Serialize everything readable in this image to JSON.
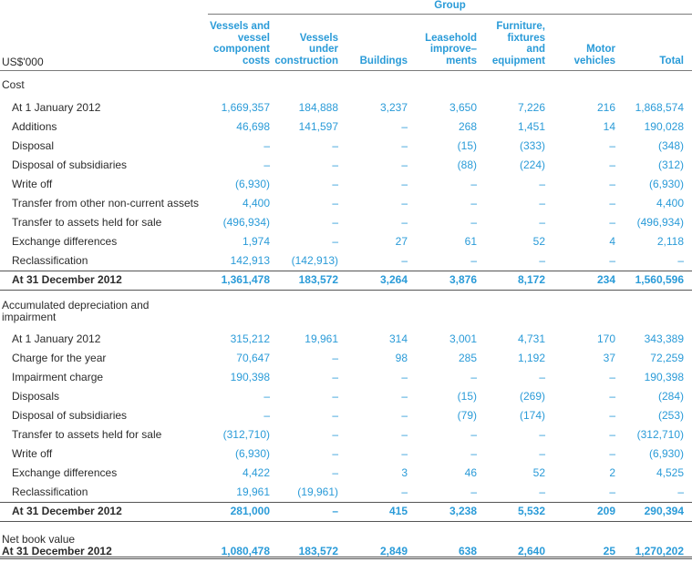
{
  "group_label": "Group",
  "unit_label": "US$'000",
  "columns": [
    [
      "Vessels and",
      "vessel",
      "component",
      "costs"
    ],
    [
      "Vessels",
      "under",
      "construction"
    ],
    [
      "Buildings"
    ],
    [
      "Leasehold",
      "improve–",
      "ments"
    ],
    [
      "Furniture,",
      "fixtures",
      "and",
      "equipment"
    ],
    [
      "Motor",
      "vehicles"
    ],
    [
      "Total"
    ]
  ],
  "sections": [
    {
      "title": [
        "Cost"
      ],
      "rows": [
        {
          "label": "At 1 January 2012",
          "values": [
            "1,669,357",
            "184,888",
            "3,237",
            "3,650",
            "7,226",
            "216",
            "1,868,574"
          ]
        },
        {
          "label": "Additions",
          "values": [
            "46,698",
            "141,597",
            "–",
            "268",
            "1,451",
            "14",
            "190,028"
          ]
        },
        {
          "label": "Disposal",
          "values": [
            "–",
            "–",
            "–",
            "(15)",
            "(333)",
            "–",
            "(348)"
          ]
        },
        {
          "label": "Disposal of subsidiaries",
          "values": [
            "–",
            "–",
            "–",
            "(88)",
            "(224)",
            "–",
            "(312)"
          ]
        },
        {
          "label": "Write off",
          "values": [
            "(6,930)",
            "–",
            "–",
            "–",
            "–",
            "–",
            "(6,930)"
          ]
        },
        {
          "label": "Transfer from other non-current assets",
          "values": [
            "4,400",
            "–",
            "–",
            "–",
            "–",
            "–",
            "4,400"
          ]
        },
        {
          "label": "Transfer to assets held for sale",
          "values": [
            "(496,934)",
            "–",
            "–",
            "–",
            "–",
            "–",
            "(496,934)"
          ]
        },
        {
          "label": "Exchange differences",
          "values": [
            "1,974",
            "–",
            "27",
            "61",
            "52",
            "4",
            "2,118"
          ]
        },
        {
          "label": "Reclassification",
          "values": [
            "142,913",
            "(142,913)",
            "–",
            "–",
            "–",
            "–",
            "–"
          ]
        },
        {
          "label": "At 31 December 2012",
          "bold": true,
          "values": [
            "1,361,478",
            "183,572",
            "3,264",
            "3,876",
            "8,172",
            "234",
            "1,560,596"
          ]
        }
      ]
    },
    {
      "title": [
        "Accumulated depreciation and",
        "impairment"
      ],
      "rows": [
        {
          "label": "At 1 January 2012",
          "values": [
            "315,212",
            "19,961",
            "314",
            "3,001",
            "4,731",
            "170",
            "343,389"
          ]
        },
        {
          "label": "Charge for the year",
          "values": [
            "70,647",
            "–",
            "98",
            "285",
            "1,192",
            "37",
            "72,259"
          ]
        },
        {
          "label": "Impairment charge",
          "values": [
            "190,398",
            "–",
            "–",
            "–",
            "–",
            "–",
            "190,398"
          ]
        },
        {
          "label": "Disposals",
          "values": [
            "–",
            "–",
            "–",
            "(15)",
            "(269)",
            "–",
            "(284)"
          ]
        },
        {
          "label": "Disposal of subsidiaries",
          "values": [
            "–",
            "–",
            "–",
            "(79)",
            "(174)",
            "–",
            "(253)"
          ]
        },
        {
          "label": "Transfer to assets held for sale",
          "values": [
            "(312,710)",
            "–",
            "–",
            "–",
            "–",
            "–",
            "(312,710)"
          ]
        },
        {
          "label": "Write off",
          "values": [
            "(6,930)",
            "–",
            "–",
            "–",
            "–",
            "–",
            "(6,930)"
          ]
        },
        {
          "label": "Exchange differences",
          "values": [
            "4,422",
            "–",
            "3",
            "46",
            "52",
            "2",
            "4,525"
          ]
        },
        {
          "label": "Reclassification",
          "values": [
            "19,961",
            "(19,961)",
            "–",
            "–",
            "–",
            "–",
            "–"
          ]
        },
        {
          "label": "At 31 December 2012",
          "bold": true,
          "values": [
            "281,000",
            "–",
            "415",
            "3,238",
            "5,532",
            "209",
            "290,394"
          ]
        }
      ]
    },
    {
      "title": [
        "Net book value"
      ],
      "rows": [
        {
          "label": "At 31 December 2012",
          "bold": true,
          "values": [
            "1,080,478",
            "183,572",
            "2,849",
            "638",
            "2,640",
            "25",
            "1,270,202"
          ]
        }
      ]
    }
  ]
}
